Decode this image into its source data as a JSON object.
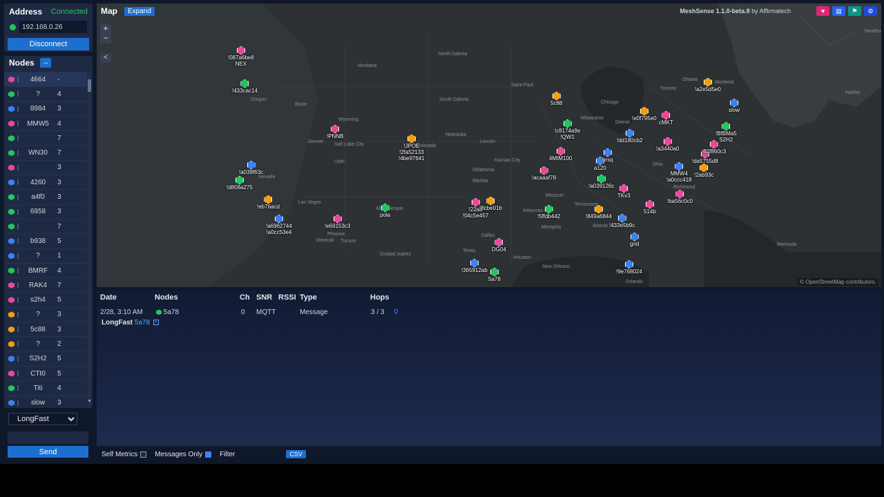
{
  "address": {
    "title": "Address",
    "status": "Connected",
    "ip_value": "192.168.0.26",
    "disconnect_label": "Disconnect"
  },
  "nodes_panel": {
    "title": "Nodes",
    "arrow": "→",
    "nodes": [
      {
        "name": "4664",
        "hops": "-",
        "color": "#ec4899"
      },
      {
        "name": "?",
        "hops": "4",
        "color": "#22c55e"
      },
      {
        "name": "8984",
        "hops": "3",
        "color": "#3b82f6"
      },
      {
        "name": "MMW5",
        "hops": "4",
        "color": "#ec4899"
      },
      {
        "name": "",
        "hops": "7",
        "color": "#22c55e"
      },
      {
        "name": "WN30",
        "hops": "7",
        "color": "#22c55e"
      },
      {
        "name": "",
        "hops": "3",
        "color": "#ec4899"
      },
      {
        "name": "4260",
        "hops": "3",
        "color": "#3b82f6"
      },
      {
        "name": "a4f0",
        "hops": "3",
        "color": "#22c55e"
      },
      {
        "name": "6958",
        "hops": "3",
        "color": "#22c55e"
      },
      {
        "name": "",
        "hops": "7",
        "color": "#22c55e"
      },
      {
        "name": "b938",
        "hops": "5",
        "color": "#3b82f6"
      },
      {
        "name": "?",
        "hops": "1",
        "color": "#3b82f6"
      },
      {
        "name": "BMRF",
        "hops": "4",
        "color": "#22c55e"
      },
      {
        "name": "RAK4",
        "hops": "7",
        "color": "#ec4899"
      },
      {
        "name": "s2h4",
        "hops": "5",
        "color": "#ec4899"
      },
      {
        "name": "?",
        "hops": "3",
        "color": "#f59e0b"
      },
      {
        "name": "5c88",
        "hops": "3",
        "color": "#f59e0b"
      },
      {
        "name": "?",
        "hops": "2",
        "color": "#f59e0b"
      },
      {
        "name": "S2H2",
        "hops": "5",
        "color": "#3b82f6"
      },
      {
        "name": "CTt0",
        "hops": "5",
        "color": "#ec4899"
      },
      {
        "name": "Titi",
        "hops": "4",
        "color": "#22c55e"
      },
      {
        "name": "slow",
        "hops": "3",
        "color": "#3b82f6"
      }
    ]
  },
  "channel": {
    "selected": "LongFast"
  },
  "send_label": "Send",
  "map": {
    "title": "Map",
    "expand_label": "Expand",
    "version_app": "MeshSense 1.1.0-beta.8",
    "version_by": "by Affirmatech",
    "zoom_in": "+",
    "zoom_out": "−",
    "collapse": "<",
    "credit": "© OpenStreetMap contributors.",
    "places": [
      "Saint Paul",
      "Chicago",
      "Kansas City",
      "Denver",
      "Salt Lake City",
      "Boise",
      "Oregon",
      "Montana",
      "North Dakota",
      "South Dakota",
      "Nebraska",
      "Wyoming",
      "Colorado",
      "Utah",
      "Nevada",
      "Las Vegas",
      "Phoenix",
      "Tucson",
      "Albuquerque",
      "Oklahoma",
      "Dallas",
      "Texas",
      "Houston",
      "New Orleans",
      "Orlando",
      "Memphis",
      "Atlanta",
      "Richmond",
      "Milwaukee",
      "Detroit",
      "Toronto",
      "Ottawa",
      "Montreal",
      "Lincoln",
      "Wichita",
      "Mexicali",
      "Ciudad Juárez",
      "Bermuda",
      "Newfoundland",
      "Halifax",
      "Arkansas",
      "Tennessee",
      "Missouri",
      "Ohio"
    ],
    "markers": [
      {
        "label": "!087a6be8\nNEX",
        "color": "#ec4899"
      },
      {
        "label": "!433cac14",
        "color": "#22c55e"
      },
      {
        "label": "!a038f63c",
        "color": "#3b82f6"
      },
      {
        "label": "!d808a275",
        "color": "#22c55e"
      },
      {
        "label": "!eb76acd",
        "color": "#f59e0b"
      },
      {
        "label": "!a6962744\n!a0cc53e4",
        "color": "#3b82f6"
      },
      {
        "label": "!e69153c3",
        "color": "#ec4899"
      },
      {
        "label": "!PNNB",
        "color": "#ec4899"
      },
      {
        "label": "!JPOE\n!2fa52133\n!4be97641",
        "color": "#f59e0b"
      },
      {
        "label": "pola",
        "color": "#22c55e"
      },
      {
        "label": "!22ab\n!04c5e457",
        "color": "#ec4899"
      },
      {
        "label": "!8cbe01b",
        "color": "#f59e0b"
      },
      {
        "label": "!365912ab",
        "color": "#3b82f6"
      },
      {
        "label": "5a78",
        "color": "#22c55e"
      },
      {
        "label": "DG04",
        "color": "#ec4899"
      },
      {
        "label": "!5ffdb442",
        "color": "#22c55e"
      },
      {
        "label": "!849a6844",
        "color": "#f59e0b"
      },
      {
        "label": "!433e5b9c",
        "color": "#3b82f6"
      },
      {
        "label": "grid",
        "color": "#3b82f6"
      },
      {
        "label": "!9e768024",
        "color": "#3b82f6"
      },
      {
        "label": "514b",
        "color": "#ec4899"
      },
      {
        "label": "TKv3",
        "color": "#ec4899"
      },
      {
        "label": "!ba56c0c0",
        "color": "#ec4899"
      },
      {
        "label": "!acaaaf78",
        "color": "#ec4899"
      },
      {
        "label": "!a039126c",
        "color": "#22c55e"
      },
      {
        "label": "a120",
        "color": "#3b82f6"
      },
      {
        "label": "hrsq",
        "color": "#3b82f6"
      },
      {
        "label": "4MtM100",
        "color": "#ec4899"
      },
      {
        "label": "!c8174a9e\n!QW1",
        "color": "#22c55e"
      },
      {
        "label": "5c88",
        "color": "#f59e0b"
      },
      {
        "label": "!e0f795e0",
        "color": "#f59e0b"
      },
      {
        "label": "cMKT",
        "color": "#ec4899"
      },
      {
        "label": "!dd180cb2",
        "color": "#3b82f6"
      },
      {
        "label": "!a3440a0",
        "color": "#ec4899"
      },
      {
        "label": "MMW4\n!a0ccc418",
        "color": "#3b82f6"
      },
      {
        "label": "!da5755d8",
        "color": "#ec4899"
      },
      {
        "label": "!62f860c3",
        "color": "#ec4899"
      },
      {
        "label": "!2ab93c",
        "color": "#f59e0b"
      },
      {
        "label": "!BfBMa5\nS2H2",
        "color": "#22c55e"
      },
      {
        "label": "slow",
        "color": "#3b82f6"
      },
      {
        "label": "!a2e5d5e0",
        "color": "#f59e0b"
      }
    ]
  },
  "messages": {
    "columns": [
      "Date",
      "Nodes",
      "Ch",
      "SNR",
      "RSSI",
      "Type",
      "Hops"
    ],
    "rows": [
      {
        "date": "2/28, 3:10 AM",
        "node": "5a78",
        "ch": "0",
        "snr": "MQTT",
        "rssi": "",
        "type": "Message",
        "hops": "3 / 3"
      }
    ],
    "sub_channel": "LongFast",
    "sub_node": "5a78"
  },
  "footer": {
    "self_metrics": "Self Metrics",
    "messages_only": "Messages Only",
    "filter": "Filter",
    "csv": "CSV"
  }
}
